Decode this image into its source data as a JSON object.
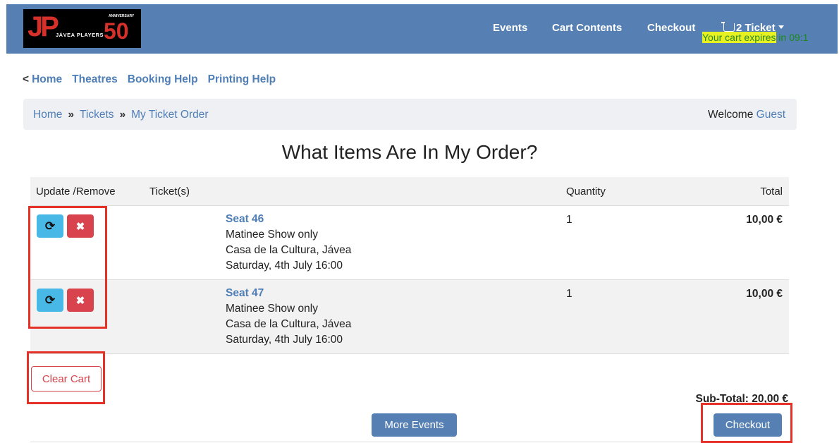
{
  "brand": {
    "logo_letters": "JP",
    "logo_name": "JÁVEA PLAYERS",
    "logo_anniversary": "ANNIVERSARY",
    "logo_number": "50"
  },
  "navbar": {
    "events": "Events",
    "cart_contents": "Cart Contents",
    "checkout": "Checkout",
    "ticket": "2 Ticket",
    "expires_highlight": "Your cart expires",
    "expires_rest": " in 09:1"
  },
  "topnav": {
    "prefix": "<",
    "home": "Home",
    "theatres": "Theatres",
    "booking_help": "Booking Help",
    "printing_help": "Printing Help"
  },
  "breadcrumb": {
    "home": "Home",
    "sep": "»",
    "tickets": "Tickets",
    "current": "My Ticket Order",
    "welcome": "Welcome",
    "guest": "Guest"
  },
  "page": {
    "title": "What Items Are In My Order?"
  },
  "table": {
    "headers": {
      "update_remove": "Update /Remove",
      "tickets": "Ticket(s)",
      "quantity": "Quantity",
      "total": "Total"
    },
    "rows": [
      {
        "seat": "Seat 46",
        "show": "Matinee Show only",
        "venue": "Casa de la Cultura, Jávea",
        "date": "Saturday, 4th July 16:00",
        "quantity": "1",
        "total": "10,00 €"
      },
      {
        "seat": "Seat 47",
        "show": "Matinee Show only",
        "venue": "Casa de la Cultura, Jávea",
        "date": "Saturday, 4th July 16:00",
        "quantity": "1",
        "total": "10,00 €"
      }
    ]
  },
  "actions": {
    "clear_cart": "Clear Cart",
    "subtotal": "Sub-Total: 20,00 €",
    "more_events": "More Events",
    "checkout": "Checkout"
  },
  "icons": {
    "update": "refresh-icon",
    "remove": "close-icon"
  },
  "colors": {
    "navbar": "#5680b4",
    "link": "#4f7eb6",
    "update_button": "#48b8e6",
    "remove_button": "#d9434e",
    "highlight_box": "#e53228"
  }
}
